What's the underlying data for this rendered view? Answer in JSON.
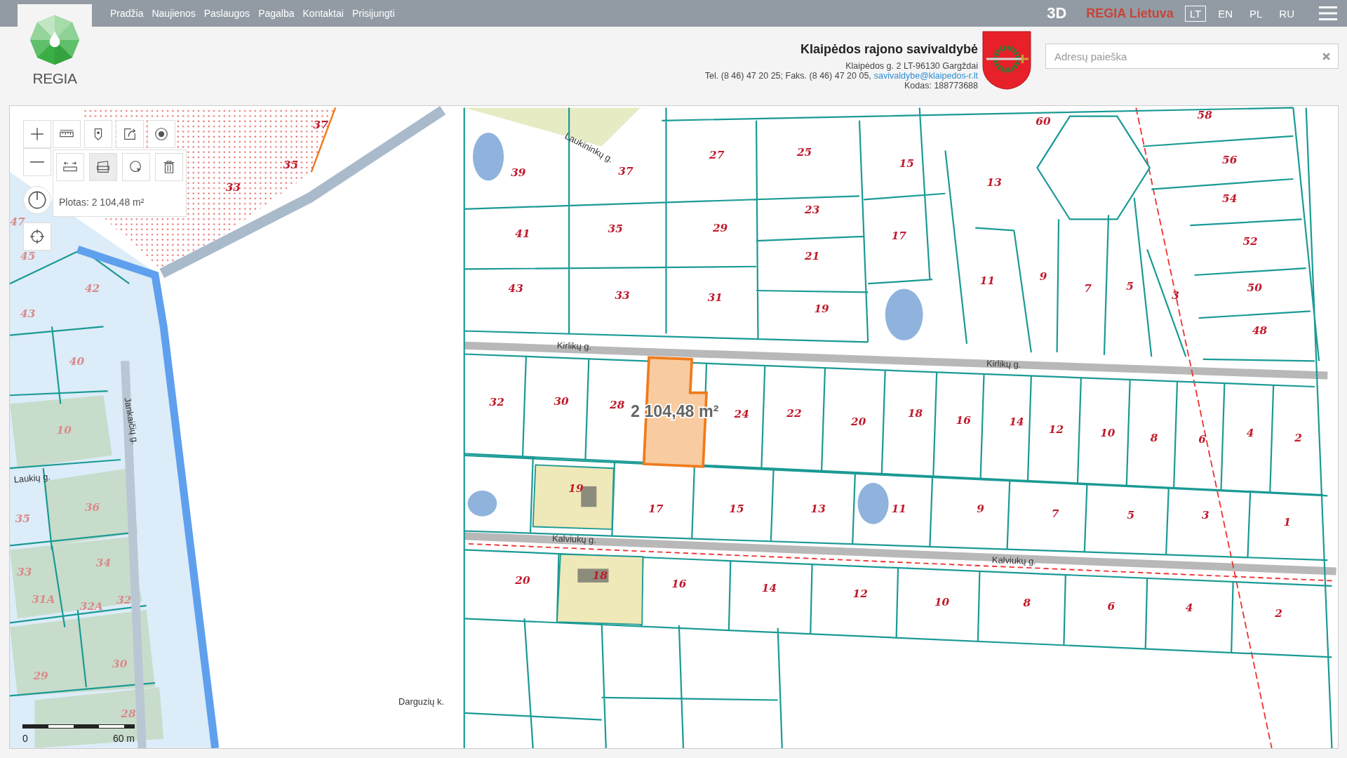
{
  "topbar": {
    "nav": [
      "Pradžia",
      "Naujienos",
      "Paslaugos",
      "Pagalba",
      "Kontaktai",
      "Prisijungti"
    ],
    "mode": "3D",
    "brand": "REGIA Lietuva",
    "languages": [
      {
        "label": "LT",
        "selected": true
      },
      {
        "label": "EN",
        "selected": false
      },
      {
        "label": "PL",
        "selected": false
      },
      {
        "label": "RU",
        "selected": false
      }
    ]
  },
  "header": {
    "logo_text": "REGIA",
    "municipality": {
      "name": "Klaipėdos rajono savivaldybė",
      "address": "Klaipėdos g. 2 LT-96130 Gargždai",
      "phone_fax": "Tel. (8 46) 47 20 25; Faks. (8 46) 47 20 05,",
      "email": "savivaldybe@klaipedos-r.lt",
      "code": "Kodas: 188773688"
    },
    "search": {
      "placeholder": "Adresų paieška"
    }
  },
  "map_tools": {
    "top_row": [
      {
        "kind": "measure"
      },
      {
        "kind": "pin"
      },
      {
        "kind": "share"
      },
      {
        "kind": "target"
      }
    ],
    "measure_row": [
      {
        "kind": "distance",
        "selected": false
      },
      {
        "kind": "area",
        "selected": true
      },
      {
        "kind": "globe",
        "selected": false
      },
      {
        "kind": "delete",
        "selected": false
      }
    ],
    "reading": "Plotas: 2 104,48 m²"
  },
  "map": {
    "parcels": [
      "37",
      "35",
      "33",
      "39",
      "37",
      "27",
      "25",
      "15",
      "13",
      "60",
      "58",
      "56",
      "54",
      "52",
      "50",
      "48",
      "41",
      "35",
      "29",
      "23",
      "21",
      "17",
      "11",
      "9",
      "7",
      "5",
      "3",
      "43",
      "33",
      "31",
      "19",
      "32",
      "30",
      "28",
      "24",
      "22",
      "20",
      "18",
      "16",
      "14",
      "12",
      "10",
      "8",
      "6",
      "4",
      "2",
      "19",
      "17",
      "15",
      "13",
      "11",
      "9",
      "7",
      "5",
      "3",
      "1",
      "20",
      "18",
      "16",
      "14",
      "12",
      "10",
      "8",
      "6",
      "4",
      "2",
      "47",
      "45",
      "42",
      "43",
      "40",
      "10",
      "36",
      "35",
      "33",
      "34",
      "32",
      "32A",
      "31A",
      "30",
      "29",
      "28"
    ],
    "streets": [
      "Laukininkų g.",
      "Kirlikų g.",
      "Kirlikų g.",
      "Jankaičių g.",
      "Laukių g.",
      "Kalviukų g.",
      "Kalviukų g.",
      "Darguzių k."
    ],
    "measured_area": "2 104,48 m²",
    "scale": {
      "start": "0",
      "end": "60 m"
    }
  }
}
